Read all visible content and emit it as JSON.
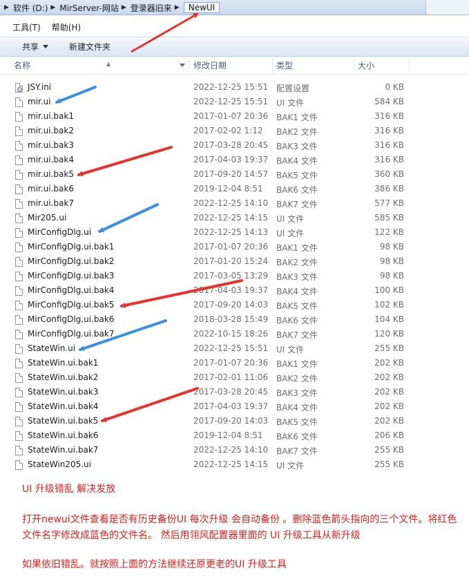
{
  "breadcrumb": [
    "软件 (D:)",
    "MirServer-网站",
    "登录器旧来",
    "NewUI"
  ],
  "menu": [
    "工具(T)",
    "帮助(H)"
  ],
  "toolbar": {
    "share_label": "共享",
    "new_folder_label": "新建文件夹"
  },
  "columns": {
    "name": "名称",
    "date": "修改日期",
    "type": "类型",
    "size": "大小"
  },
  "files": [
    {
      "name": "JSY.ini",
      "date": "2022-12-25 15:51",
      "type": "配置设置",
      "size": "0 KB",
      "icon": "settings-file-icon"
    },
    {
      "name": "mir.ui",
      "date": "2022-12-25 15:51",
      "type": "UI 文件",
      "size": "584 KB",
      "icon": "file-icon"
    },
    {
      "name": "mir.ui.bak1",
      "date": "2017-01-07 20:36",
      "type": "BAK1 文件",
      "size": "316 KB",
      "icon": "file-icon"
    },
    {
      "name": "mir.ui.bak2",
      "date": "2017-02-02 1:12",
      "type": "BAK2 文件",
      "size": "316 KB",
      "icon": "file-icon"
    },
    {
      "name": "mir.ui.bak3",
      "date": "2017-03-28 20:45",
      "type": "BAK3 文件",
      "size": "316 KB",
      "icon": "file-icon"
    },
    {
      "name": "mir.ui.bak4",
      "date": "2017-04-03 19:37",
      "type": "BAK4 文件",
      "size": "316 KB",
      "icon": "file-icon"
    },
    {
      "name": "mir.ui.bak5",
      "date": "2017-09-20 14:57",
      "type": "BAK5 文件",
      "size": "360 KB",
      "icon": "file-icon"
    },
    {
      "name": "mir.ui.bak6",
      "date": "2019-12-04 8:51",
      "type": "BAK6 文件",
      "size": "386 KB",
      "icon": "file-icon"
    },
    {
      "name": "mir.ui.bak7",
      "date": "2022-12-25 14:10",
      "type": "BAK7 文件",
      "size": "577 KB",
      "icon": "file-icon"
    },
    {
      "name": "Mir205.ui",
      "date": "2022-12-25 14:15",
      "type": "UI 文件",
      "size": "585 KB",
      "icon": "file-icon"
    },
    {
      "name": "MirConfigDlg.ui",
      "date": "2022-12-25 14:13",
      "type": "UI 文件",
      "size": "122 KB",
      "icon": "file-icon"
    },
    {
      "name": "MirConfigDlg.ui.bak1",
      "date": "2017-01-07 20:36",
      "type": "BAK1 文件",
      "size": "98 KB",
      "icon": "file-icon"
    },
    {
      "name": "MirConfigDlg.ui.bak2",
      "date": "2017-01-20 15:24",
      "type": "BAK2 文件",
      "size": "98 KB",
      "icon": "file-icon"
    },
    {
      "name": "MirConfigDlg.ui.bak3",
      "date": "2017-03-05 13:29",
      "type": "BAK3 文件",
      "size": "98 KB",
      "icon": "file-icon"
    },
    {
      "name": "MirConfigDlg.ui.bak4",
      "date": "2017-04-03 19:37",
      "type": "BAK4 文件",
      "size": "100 KB",
      "icon": "file-icon"
    },
    {
      "name": "MirConfigDlg.ui.bak5",
      "date": "2017-09-20 14:03",
      "type": "BAK5 文件",
      "size": "102 KB",
      "icon": "file-icon"
    },
    {
      "name": "MirConfigDlg.ui.bak6",
      "date": "2018-03-28 15:49",
      "type": "BAK6 文件",
      "size": "104 KB",
      "icon": "file-icon"
    },
    {
      "name": "MirConfigDlg.ui.bak7",
      "date": "2022-10-15 18:26",
      "type": "BAK7 文件",
      "size": "120 KB",
      "icon": "file-icon"
    },
    {
      "name": "StateWin.ui",
      "date": "2022-12-25 15:51",
      "type": "UI 文件",
      "size": "255 KB",
      "icon": "file-icon"
    },
    {
      "name": "StateWin.ui.bak1",
      "date": "2017-01-07 20:36",
      "type": "BAK1 文件",
      "size": "202 KB",
      "icon": "file-icon"
    },
    {
      "name": "StateWin.ui.bak2",
      "date": "2017-02-01 11:06",
      "type": "BAK2 文件",
      "size": "202 KB",
      "icon": "file-icon"
    },
    {
      "name": "StateWin.ui.bak3",
      "date": "2017-03-28 20:45",
      "type": "BAK3 文件",
      "size": "202 KB",
      "icon": "file-icon"
    },
    {
      "name": "StateWin.ui.bak4",
      "date": "2017-04-03 19:37",
      "type": "BAK4 文件",
      "size": "202 KB",
      "icon": "file-icon"
    },
    {
      "name": "StateWin.ui.bak5",
      "date": "2017-09-20 14:03",
      "type": "BAK5 文件",
      "size": "202 KB",
      "icon": "file-icon"
    },
    {
      "name": "StateWin.ui.bak6",
      "date": "2019-12-04 8:51",
      "type": "BAK6 文件",
      "size": "206 KB",
      "icon": "file-icon"
    },
    {
      "name": "StateWin.ui.bak7",
      "date": "2022-12-25 14:10",
      "type": "BAK7 文件",
      "size": "255 KB",
      "icon": "file-icon"
    },
    {
      "name": "StateWin205.ui",
      "date": "2022-12-25 14:15",
      "type": "UI 文件",
      "size": "255 KB",
      "icon": "file-icon"
    }
  ],
  "notes": {
    "title": "UI 升级错乱   解决发放",
    "body": "打开newui文件查看是否有历史备份UI 每次升级 会自动备份 。删除蓝色箭头指向的三个文件。将红色文件名字修改成蓝色的文件名。 然后用翎风配置器里面的 UI 升级工具从新升级",
    "footer": "如果依旧错乱。就按照上面的方法继续还原更老的UI 升级工具"
  },
  "colors": {
    "red_arrow": "#e8312b",
    "blue_arrow": "#3a8ee6",
    "note_text": "#e2211c"
  }
}
